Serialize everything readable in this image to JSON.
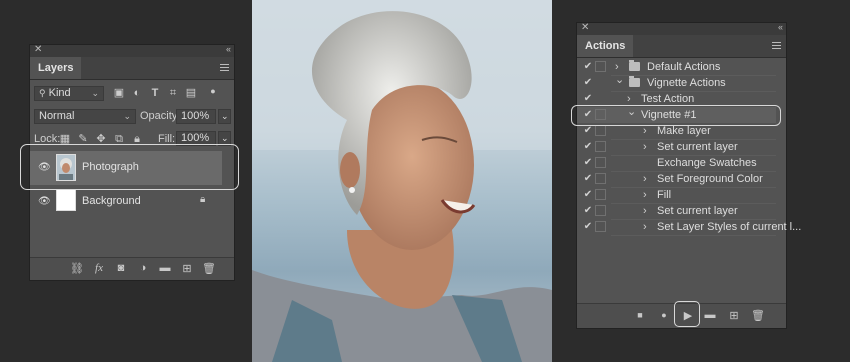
{
  "layers_panel": {
    "close_glyph": "✕",
    "collapse_glyph": "‹‹",
    "tab_label": "Layers",
    "filter_value": "Kind",
    "blend_mode": "Normal",
    "opacity_label": "Opacity:",
    "opacity_value": "100%",
    "lock_label": "Lock:",
    "fill_label": "Fill:",
    "fill_value": "100%",
    "layers": [
      {
        "name": "Photograph",
        "selected": true
      },
      {
        "name": "Background",
        "selected": false
      }
    ],
    "footer_icons": [
      "link-icon",
      "fx-icon",
      "mask-icon",
      "adjustment-icon",
      "folder-icon",
      "new-layer-icon",
      "trash-icon"
    ],
    "fx_label": "fx"
  },
  "actions_panel": {
    "close_glyph": "✕",
    "collapse_glyph": "‹‹",
    "tab_label": "Actions",
    "rows": [
      {
        "text": "Default Actions",
        "level": 0,
        "folder": true,
        "arrow": "›"
      },
      {
        "text": "Vignette Actions",
        "level": 0,
        "folder": true,
        "arrow": "⌄"
      },
      {
        "text": "Test Action",
        "level": 1,
        "folder": false,
        "arrow": "›"
      },
      {
        "text": "Vignette #1",
        "level": 1,
        "folder": false,
        "arrow": "⌄",
        "highlight": true
      },
      {
        "text": "Make layer",
        "level": 2,
        "folder": false,
        "arrow": "›"
      },
      {
        "text": "Set current layer",
        "level": 2,
        "folder": false,
        "arrow": "›"
      },
      {
        "text": "Exchange Swatches",
        "level": 2,
        "folder": false,
        "arrow": ""
      },
      {
        "text": "Set Foreground Color",
        "level": 2,
        "folder": false,
        "arrow": "›"
      },
      {
        "text": "Fill",
        "level": 2,
        "folder": false,
        "arrow": "›"
      },
      {
        "text": "Set current layer",
        "level": 2,
        "folder": false,
        "arrow": "›"
      },
      {
        "text": "Set Layer Styles of current l...",
        "level": 2,
        "folder": false,
        "arrow": "›"
      }
    ],
    "check_glyph": "✔",
    "footer": {
      "stop": "■",
      "record": "●",
      "play": "▶"
    }
  },
  "colors": {
    "panel": "#535353",
    "background": "#2c2c2c",
    "highlight_ring": "#d8d8d8"
  }
}
